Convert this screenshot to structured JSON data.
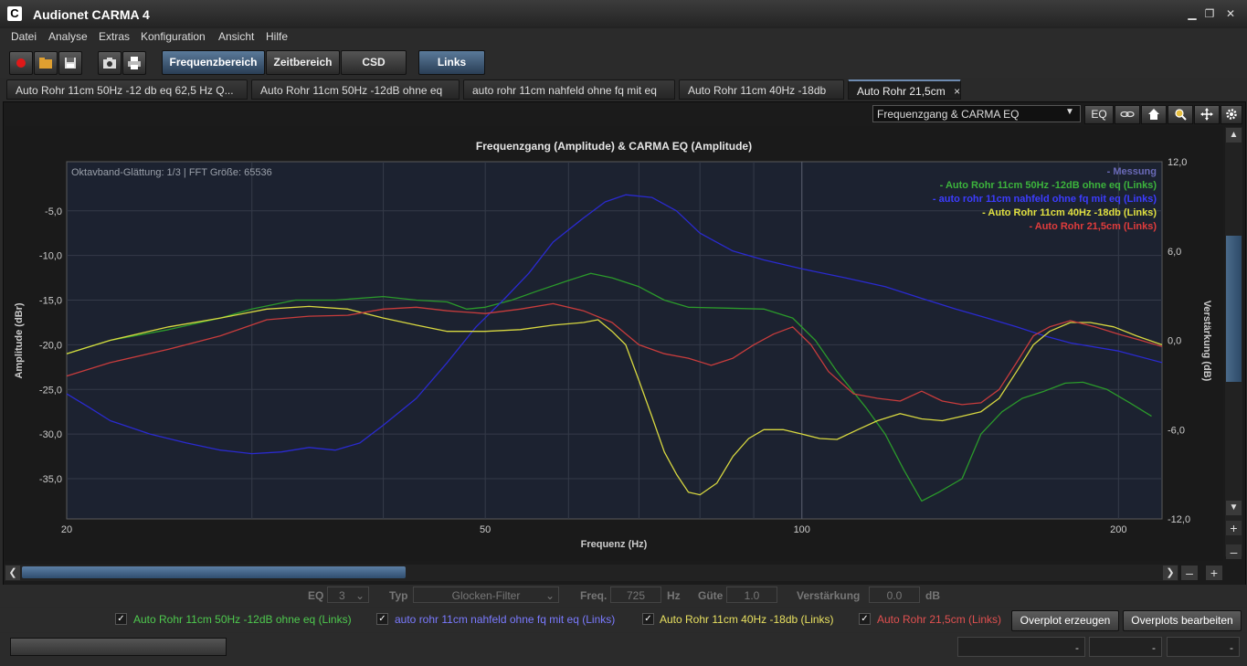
{
  "window": {
    "title": "Audionet CARMA 4",
    "icon_letter": "C"
  },
  "menu": [
    "Datei",
    "Analyse",
    "Extras",
    "Konfiguration",
    "Ansicht",
    "Hilfe"
  ],
  "toolbar": {
    "views": [
      "Frequenzbereich",
      "Zeitbereich",
      "CSD"
    ],
    "channel": "Links"
  },
  "tabs": [
    "Auto Rohr 11cm 50Hz -12 db eq 62,5 Hz Q...",
    "Auto Rohr 11cm 50Hz -12dB ohne eq",
    "auto rohr 11cm nahfeld ohne fq mit eq",
    "Auto Rohr 11cm 40Hz -18db",
    "Auto Rohr 21,5cm"
  ],
  "tab_close": "×",
  "panel": {
    "view_select": "Frequenzgang & CARMA EQ",
    "eq_button": "EQ"
  },
  "eqbar": {
    "eq_label": "EQ",
    "eq_value": "3",
    "typ_label": "Typ",
    "typ_value": "Glocken-Filter",
    "freq_label": "Freq.",
    "freq_value": "725",
    "freq_unit": "Hz",
    "guete_label": "Güte",
    "guete_value": "1.0",
    "gain_label": "Verstärkung",
    "gain_value": "0.0",
    "gain_unit": "dB"
  },
  "overplot": {
    "items": [
      {
        "label": "Auto Rohr 11cm 50Hz -12dB ohne eq (Links)",
        "color": "#4ec94e"
      },
      {
        "label": "auto rohr 11cm nahfeld ohne fq mit eq (Links)",
        "color": "#7a7aff"
      },
      {
        "label": "Auto Rohr 11cm 40Hz -18db (Links)",
        "color": "#e8e060"
      },
      {
        "label": "Auto Rohr 21,5cm (Links)",
        "color": "#e05050"
      }
    ],
    "create": "Overplot erzeugen",
    "edit": "Overplots bearbeiten"
  },
  "status": [
    "-",
    "-",
    "-"
  ],
  "chart_data": {
    "type": "line",
    "title": "Frequenzgang (Amplitude) & CARMA EQ (Amplitude)",
    "info": "Oktavband-Glättung: 1/3 | FFT Größe: 65536",
    "xlabel": "Frequenz (Hz)",
    "ylabel": "Amplitude (dBr)",
    "y2label": "Verstärkung (dB)",
    "x_scale": "log",
    "xlim": [
      20,
      220
    ],
    "ylim": [
      -39.5,
      0.5
    ],
    "y2lim": [
      -12,
      12
    ],
    "xticks": [
      20,
      50,
      100,
      200
    ],
    "yticks": [
      -5,
      -10,
      -15,
      -20,
      -25,
      -30,
      -35
    ],
    "ytick_labels": [
      "-5,0",
      "-10,0",
      "-15,0",
      "-20,0",
      "-25,0",
      "-30,0",
      "-35,0"
    ],
    "y2ticks": [
      12,
      6,
      0,
      -6,
      -12
    ],
    "y2tick_labels": [
      "12,0",
      "6,0",
      "0,0",
      "-6,0",
      "-12,0"
    ],
    "legend_position": "top-right",
    "legend": [
      {
        "label": "- Messung",
        "color": "#6a6ab8"
      },
      {
        "label": "- Auto Rohr 11cm 50Hz -12dB ohne eq (Links)",
        "color": "#3cb43c"
      },
      {
        "label": "- auto rohr 11cm nahfeld ohne fq mit eq (Links)",
        "color": "#3c3cff"
      },
      {
        "label": "- Auto Rohr 11cm 40Hz -18db (Links)",
        "color": "#e0e040"
      },
      {
        "label": "- Auto Rohr 21,5cm (Links)",
        "color": "#e03c3c"
      }
    ],
    "series": [
      {
        "color": "#2b9a2b",
        "points": [
          [
            20,
            -21
          ],
          [
            22,
            -19.5
          ],
          [
            25,
            -18.3
          ],
          [
            28,
            -17
          ],
          [
            30,
            -16
          ],
          [
            33,
            -15
          ],
          [
            36,
            -15
          ],
          [
            40,
            -14.6
          ],
          [
            43,
            -15
          ],
          [
            46,
            -15.2
          ],
          [
            48,
            -16
          ],
          [
            50,
            -15.8
          ],
          [
            53,
            -15
          ],
          [
            56,
            -14
          ],
          [
            60,
            -12.8
          ],
          [
            63,
            -12
          ],
          [
            66,
            -12.5
          ],
          [
            70,
            -13.5
          ],
          [
            74,
            -15
          ],
          [
            78,
            -15.8
          ],
          [
            85,
            -15.9
          ],
          [
            92,
            -16
          ],
          [
            98,
            -17
          ],
          [
            103,
            -19.5
          ],
          [
            108,
            -23
          ],
          [
            115,
            -27
          ],
          [
            120,
            -30
          ],
          [
            125,
            -34
          ],
          [
            130,
            -37.5
          ],
          [
            135,
            -36.5
          ],
          [
            142,
            -35
          ],
          [
            148,
            -30
          ],
          [
            155,
            -27.5
          ],
          [
            162,
            -26
          ],
          [
            170,
            -25.2
          ],
          [
            178,
            -24.3
          ],
          [
            185,
            -24.2
          ],
          [
            195,
            -25
          ],
          [
            205,
            -26.5
          ],
          [
            215,
            -28
          ]
        ]
      },
      {
        "color": "#2a2ad0",
        "points": [
          [
            20,
            -25.5
          ],
          [
            21,
            -27
          ],
          [
            22,
            -28.5
          ],
          [
            24,
            -30
          ],
          [
            26,
            -31
          ],
          [
            28,
            -31.8
          ],
          [
            30,
            -32.2
          ],
          [
            32,
            -32
          ],
          [
            34,
            -31.5
          ],
          [
            36,
            -31.8
          ],
          [
            38,
            -31
          ],
          [
            40,
            -29
          ],
          [
            43,
            -26
          ],
          [
            46,
            -22
          ],
          [
            49,
            -18
          ],
          [
            52,
            -15
          ],
          [
            55,
            -12
          ],
          [
            58,
            -8.5
          ],
          [
            62,
            -5.8
          ],
          [
            65,
            -4
          ],
          [
            68,
            -3.2
          ],
          [
            72,
            -3.5
          ],
          [
            76,
            -5
          ],
          [
            80,
            -7.5
          ],
          [
            86,
            -9.5
          ],
          [
            92,
            -10.5
          ],
          [
            100,
            -11.5
          ],
          [
            110,
            -12.5
          ],
          [
            120,
            -13.5
          ],
          [
            130,
            -14.8
          ],
          [
            140,
            -16
          ],
          [
            150,
            -17
          ],
          [
            160,
            -18
          ],
          [
            170,
            -19
          ],
          [
            180,
            -19.8
          ],
          [
            200,
            -20.7
          ],
          [
            220,
            -22
          ]
        ]
      },
      {
        "color": "#d8d840",
        "points": [
          [
            20,
            -21
          ],
          [
            22,
            -19.5
          ],
          [
            25,
            -18
          ],
          [
            28,
            -17
          ],
          [
            31,
            -16
          ],
          [
            34,
            -15.7
          ],
          [
            37,
            -16
          ],
          [
            40,
            -17
          ],
          [
            43,
            -17.8
          ],
          [
            46,
            -18.5
          ],
          [
            50,
            -18.5
          ],
          [
            54,
            -18.3
          ],
          [
            58,
            -17.8
          ],
          [
            62,
            -17.5
          ],
          [
            64,
            -17.2
          ],
          [
            66,
            -18.5
          ],
          [
            68,
            -20
          ],
          [
            70,
            -24
          ],
          [
            72,
            -28
          ],
          [
            74,
            -32
          ],
          [
            76,
            -34.5
          ],
          [
            78,
            -36.5
          ],
          [
            80,
            -36.8
          ],
          [
            83,
            -35.5
          ],
          [
            86,
            -32.5
          ],
          [
            89,
            -30.5
          ],
          [
            92,
            -29.5
          ],
          [
            96,
            -29.5
          ],
          [
            100,
            -30
          ],
          [
            104,
            -30.5
          ],
          [
            108,
            -30.6
          ],
          [
            113,
            -29.5
          ],
          [
            118,
            -28.5
          ],
          [
            124,
            -27.7
          ],
          [
            130,
            -28.3
          ],
          [
            136,
            -28.5
          ],
          [
            142,
            -28
          ],
          [
            148,
            -27.5
          ],
          [
            154,
            -26
          ],
          [
            160,
            -23
          ],
          [
            166,
            -20
          ],
          [
            172,
            -18.5
          ],
          [
            180,
            -17.5
          ],
          [
            188,
            -17.5
          ],
          [
            198,
            -18
          ],
          [
            208,
            -19
          ],
          [
            220,
            -20
          ]
        ]
      },
      {
        "color": "#c83c3c",
        "points": [
          [
            20,
            -23.5
          ],
          [
            22,
            -22
          ],
          [
            25,
            -20.5
          ],
          [
            28,
            -19
          ],
          [
            31,
            -17.2
          ],
          [
            34,
            -16.8
          ],
          [
            37,
            -16.7
          ],
          [
            40,
            -16
          ],
          [
            43,
            -15.8
          ],
          [
            46,
            -16.2
          ],
          [
            50,
            -16.5
          ],
          [
            54,
            -16
          ],
          [
            58,
            -15.4
          ],
          [
            62,
            -16.2
          ],
          [
            66,
            -17.5
          ],
          [
            70,
            -20
          ],
          [
            74,
            -21
          ],
          [
            78,
            -21.5
          ],
          [
            82,
            -22.3
          ],
          [
            86,
            -21.5
          ],
          [
            90,
            -20
          ],
          [
            94,
            -18.8
          ],
          [
            98,
            -18
          ],
          [
            102,
            -20
          ],
          [
            106,
            -23
          ],
          [
            112,
            -25.5
          ],
          [
            118,
            -26
          ],
          [
            124,
            -26.3
          ],
          [
            130,
            -25.2
          ],
          [
            136,
            -26.3
          ],
          [
            142,
            -26.7
          ],
          [
            148,
            -26.5
          ],
          [
            154,
            -25
          ],
          [
            160,
            -22
          ],
          [
            166,
            -19
          ],
          [
            172,
            -18
          ],
          [
            180,
            -17.3
          ],
          [
            190,
            -18
          ],
          [
            200,
            -18.8
          ],
          [
            210,
            -19.5
          ],
          [
            220,
            -20.2
          ]
        ]
      }
    ]
  }
}
